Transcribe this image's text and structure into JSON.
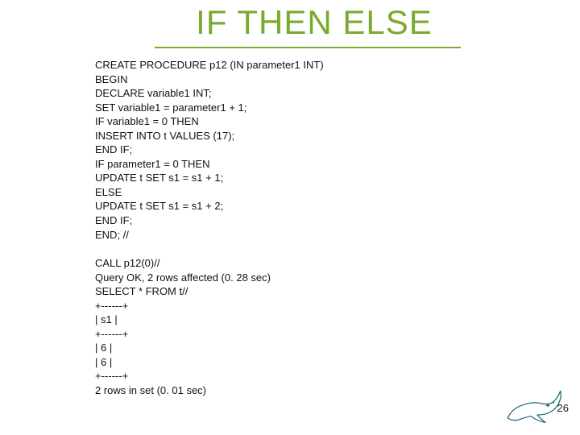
{
  "title": "IF THEN ELSE",
  "code1": [
    "CREATE PROCEDURE p12 (IN parameter1 INT)",
    "BEGIN",
    "DECLARE variable1 INT;",
    "SET variable1 = parameter1 + 1;",
    "IF variable1 = 0 THEN",
    "INSERT INTO t VALUES (17);",
    "END IF;",
    "IF parameter1 = 0 THEN",
    "UPDATE t SET s1 = s1 + 1;",
    "ELSE",
    "UPDATE t SET s1 = s1 + 2;",
    "END IF;",
    "END; //"
  ],
  "code2": [
    "CALL p12(0)//",
    "Query OK, 2 rows affected (0. 28 sec)",
    "SELECT * FROM t//",
    "+------+",
    "| s1 |",
    "+------+",
    "| 6 |",
    "| 6 |",
    "+------+",
    "2 rows in set (0. 01 sec)"
  ],
  "page_number": "26"
}
